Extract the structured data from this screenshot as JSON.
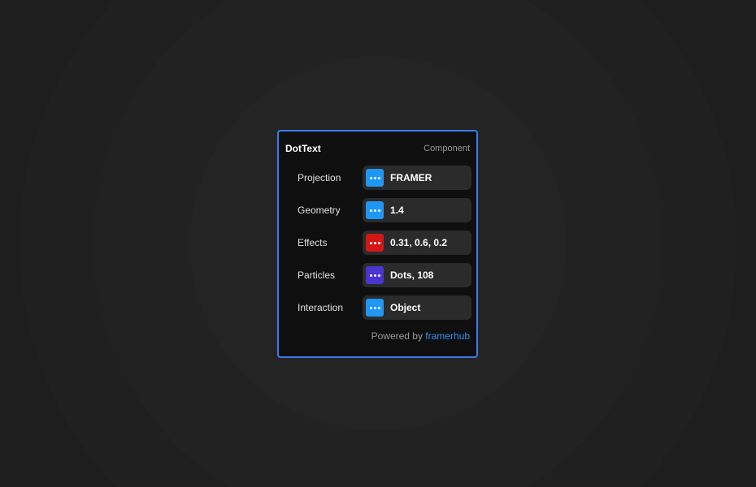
{
  "panel": {
    "title": "DotText",
    "type_label": "Component",
    "accent_color": "#3a7cf0",
    "rows": [
      {
        "label": "Projection",
        "value": "FRAMER",
        "icon": "more-dots-icon",
        "color": "#1e97f5"
      },
      {
        "label": "Geometry",
        "value": "1.4",
        "icon": "more-dots-icon",
        "color": "#1e97f5"
      },
      {
        "label": "Effects",
        "value": "0.31, 0.6, 0.2",
        "icon": "more-dots-icon",
        "color": "#d31717"
      },
      {
        "label": "Particles",
        "value": "Dots, 108",
        "icon": "more-dots-icon",
        "color": "#4a35d0"
      },
      {
        "label": "Interaction",
        "value": "Object",
        "icon": "more-dots-icon",
        "color": "#1e97f5"
      }
    ],
    "footer": {
      "prefix": "Powered by ",
      "link_text": "framerhub",
      "link_color": "#2f8ff0"
    }
  }
}
